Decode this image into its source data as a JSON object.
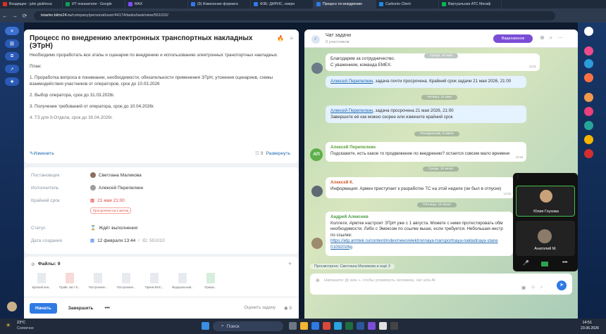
{
  "browser": {
    "tabs": [
      {
        "label": "Входящие - julie.giukhova",
        "color": "#d93025"
      },
      {
        "label": "ИТ показатели - Google",
        "color": "#0f9d58"
      },
      {
        "label": "MAX",
        "color": "#7c4dff"
      },
      {
        "label": "(9) Изменение формата",
        "color": "#2f7ae5"
      },
      {
        "label": "ФЗЕ: ДИРИС, смерн",
        "color": "#2f7ae5"
      },
      {
        "label": "Процесс по внедрению",
        "color": "#2f7ae5"
      },
      {
        "label": "Carbonio Client",
        "color": "#1e88e5"
      },
      {
        "label": "Виртуальная АТС Мегаф",
        "color": "#00b956"
      }
    ],
    "url_host": "tstarter.bitrix24.ru",
    "url_path": "/company/personal/user/44174/tasks/task/view/551010/"
  },
  "task": {
    "title": "Процесс по внедрению электронных транспортных накладных (ЭТрН)",
    "description": [
      "Необходимо проработать все этапы и сценарии по внедрению и использованию электронных транспортных накладных.",
      "План:",
      "1. Проработка вопроса в понимании, необходимости, обязательности применения ЭТрН, утонения сценариев, схемы взаимодействия участников от операторов, срок до 10.03.2026",
      "2. Выбор оператора, срок до 31.03.2026г.",
      "3. Получение требований от оператора, срок до 10.04.2026г.",
      "4. ТЗ для It-Отдела, срок до 30.04.2026г."
    ],
    "edit_label": "Изменить",
    "checklist_count": "9",
    "expand_label": "Развернуть",
    "props": {
      "creator_label": "Постановщик",
      "creator": "Светлана Маликова",
      "assignee_label": "Исполнитель",
      "assignee": "Алексей Перепелкин",
      "deadline_label": "Крайний срок",
      "deadline": "21 мая 21:00",
      "overdue_badge": "Просрочена на 1 месяц",
      "status_label": "Статус",
      "status": "Ждёт выполнения",
      "created_label": "Дата создания",
      "created": "12 февраля 13:44",
      "task_id": "ID: 551010"
    },
    "files_label": "Файлы: 9",
    "files": [
      "Краткий ана...",
      "Прайс лист Е...",
      "Построение...",
      "Построение...",
      "Прием ВНС...",
      "Федеральный...",
      "Приказ..."
    ],
    "start_button": "Начать",
    "complete_button": "Завершить",
    "more_button": "•••",
    "rate_label": "Оценить задачу",
    "views": "9"
  },
  "chat": {
    "title": "Чат задачи",
    "subtitle": "9 участников",
    "video_button": "Видеозвонок",
    "msg1": "Благодарим за сотрудничество.\nС уважением, команда EMEX.",
    "msg1_time": "11:51",
    "date1": "Среда, 20 мая",
    "sys1_name": "Алексей Перепелкин",
    "sys1_text": ", задача почти просрочена. Крайний срок задачи 21 мая 2026, 21:00",
    "sys1_time": "11:48",
    "date2": "Четверг, 21 мая",
    "sys2_name": "Алексей Перепелкин",
    "sys2_text": ", задача просрочена 21 мая 2026, 21:00",
    "sys2_text2": "Завершите её как можно скорее или измените крайний срок",
    "sys2_time": "21:00",
    "date3": "Понедельник, 8 июня",
    "msg2_author": "Алексей Перепелкин",
    "msg2_text": "Подскажите, есть какое то продвижение по внедрению? остается совсем мало времени",
    "msg2_time": "12:56",
    "msg2_avatar": "АП",
    "date4": "Среда, 10 июня",
    "msg3_author": "Алексей К.",
    "msg3_text": "Информация: Армен приступает к разработке ТС на этой неделе (он был в отпуске)",
    "msg3_time": "12:53",
    "date5": "Пятница, 19 июня",
    "msg4_author": "Андрей Алексеев",
    "msg4_lines": [
      "Коллеги, Армтек настроит ЭТрН уже с 1 августа. Можете с ними протестировать обм",
      "необходимости. Либо с Эмексом по ссылке выше, если требуется. Небольшая инстр",
      "по ссылке:"
    ],
    "msg4_link1": "https://etp.armtek.ru/content/index/news/elektronnaya-transportnaya-nakladnaya-stane",
    "msg4_link2": "01092026g",
    "viewed": "Просмотрено: Светлана Маликова и ещё 3",
    "input_placeholder": "Напишите @ или +, чтобы упомянуть человека, чат или AI"
  },
  "video": {
    "p1": "Юлия Глухова",
    "p2": "Анатолий М."
  },
  "taskbar": {
    "temp": "23°C",
    "weather": "Солнечно",
    "search": "Поиск",
    "time": "14:51",
    "date": "23.06.2026"
  }
}
